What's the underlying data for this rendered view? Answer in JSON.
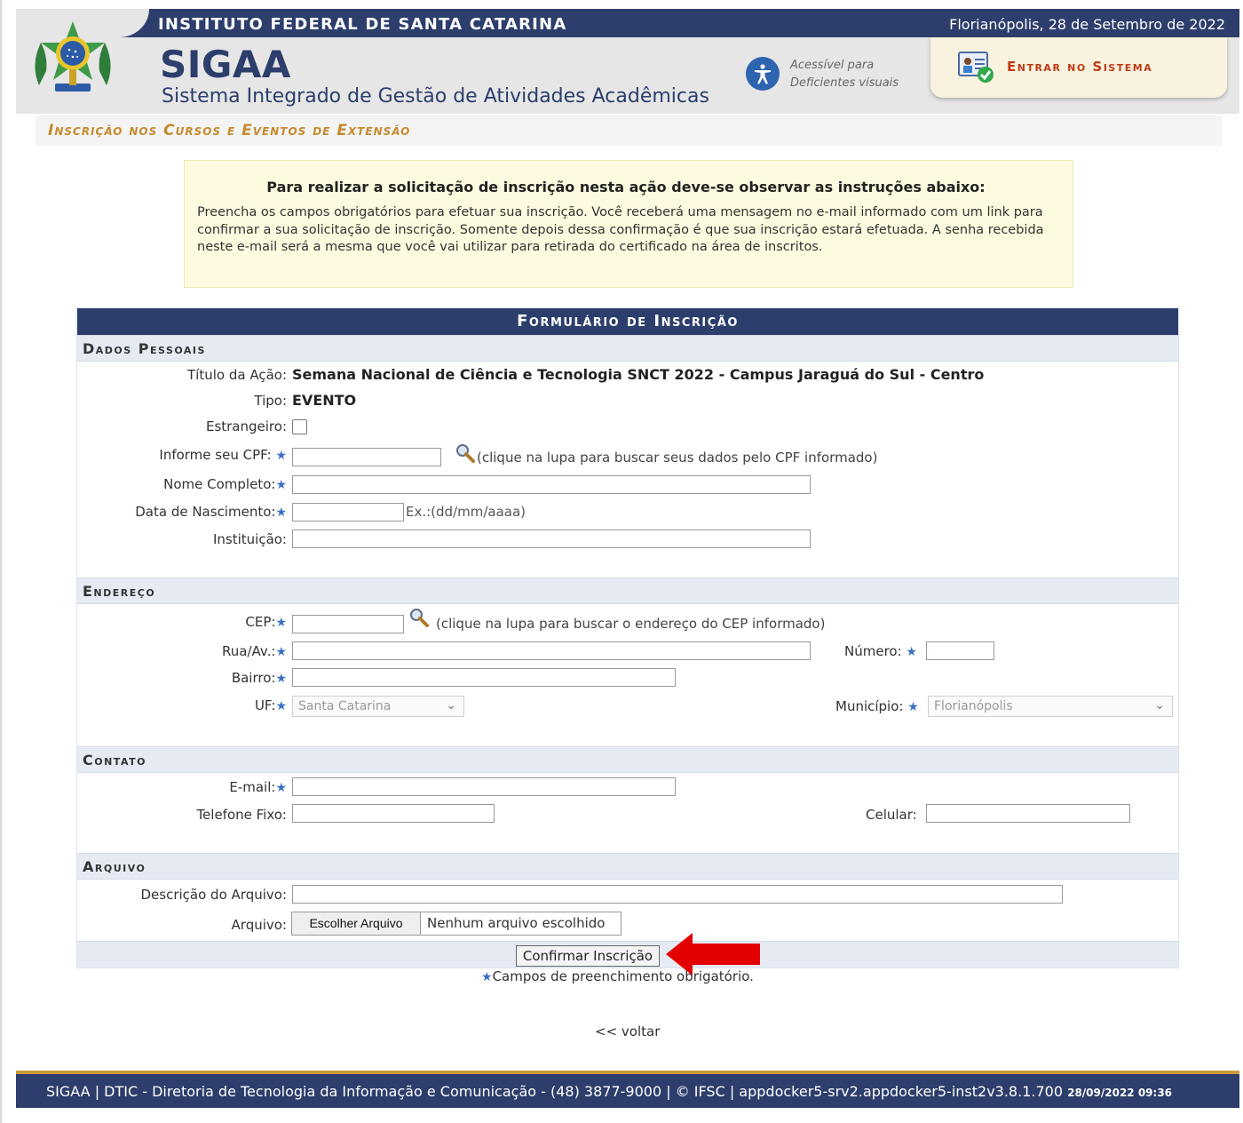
{
  "header": {
    "institution": "INSTITUTO FEDERAL DE SANTA CATARINA",
    "date": "Florianópolis, 28 de Setembro de 2022",
    "system_name": "SIGAA",
    "system_full": "Sistema Integrado de Gestão de Atividades Acadêmicas",
    "accessibility_text": "Acessível para\nDeficientes visuais",
    "login_label": "Entrar no Sistema"
  },
  "page_title": "Inscrição nos Cursos e Eventos de Extensão",
  "info": {
    "title": "Para realizar a solicitação de inscrição nesta ação deve-se observar as instruções abaixo:",
    "body": "Preencha os campos obrigatórios para efetuar sua inscrição. Você receberá uma mensagem no e-mail informado com um link para confirmar a sua solicitação de inscrição. Somente depois dessa confirmação é que sua inscrição estará efetuada. A senha recebida neste e-mail será a mesma que você vai utilizar para retirada do certificado na área de inscritos."
  },
  "form": {
    "caption": "Formulário de Inscrição",
    "sections": {
      "personal": "Dados Pessoais",
      "address": "Endereço",
      "contact": "Contato",
      "file": "Arquivo"
    },
    "labels": {
      "action_title": "Título da Ação:",
      "type": "Tipo:",
      "foreigner": "Estrangeiro:",
      "cpf": "Informe seu CPF:",
      "full_name": "Nome Completo:",
      "birth_date": "Data de Nascimento:",
      "institution": "Instituição:",
      "cep": "CEP:",
      "street": "Rua/Av.:",
      "number": "Número:",
      "district": "Bairro:",
      "uf": "UF:",
      "city": "Município:",
      "email": "E-mail:",
      "phone": "Telefone Fixo:",
      "mobile": "Celular:",
      "file_desc": "Descrição do Arquivo:",
      "file": "Arquivo:"
    },
    "values": {
      "action_title": "Semana Nacional de Ciência e Tecnologia SNCT 2022 - Campus Jaraguá do Sul - Centro",
      "type": "EVENTO",
      "uf": "Santa Catarina",
      "city": "Florianópolis",
      "file_choose": "Escolher Arquivo",
      "file_none": "Nenhum arquivo escolhido"
    },
    "hints": {
      "cpf": "(clique na lupa para buscar seus dados pelo CPF informado)",
      "birth_date": "Ex.:(dd/mm/aaaa)",
      "cep": "(clique na lupa para buscar o endereço do CEP informado)"
    },
    "submit_label": "Confirmar Inscrição",
    "required_note": "Campos de preenchimento obrigatório."
  },
  "back_link": "<< voltar",
  "footer": {
    "text": "SIGAA | DTIC - Diretoria de Tecnologia da Informação e Comunicação - (48) 3877-9000 | © IFSC | appdocker5-srv2.appdocker5-inst2v3.8.1.700",
    "timestamp": "28/09/2022 09:36"
  },
  "colors": {
    "brand_navy": "#2d3e6c",
    "title_gold": "#c68a2e",
    "login_red": "#c03a16",
    "required_star": "#3a6fc4",
    "annotation_arrow": "#e30000"
  },
  "icons": [
    "brazil-coat-of-arms-icon",
    "accessibility-icon",
    "login-user-card-icon",
    "magnifier-icon",
    "annotation-arrow-icon"
  ]
}
